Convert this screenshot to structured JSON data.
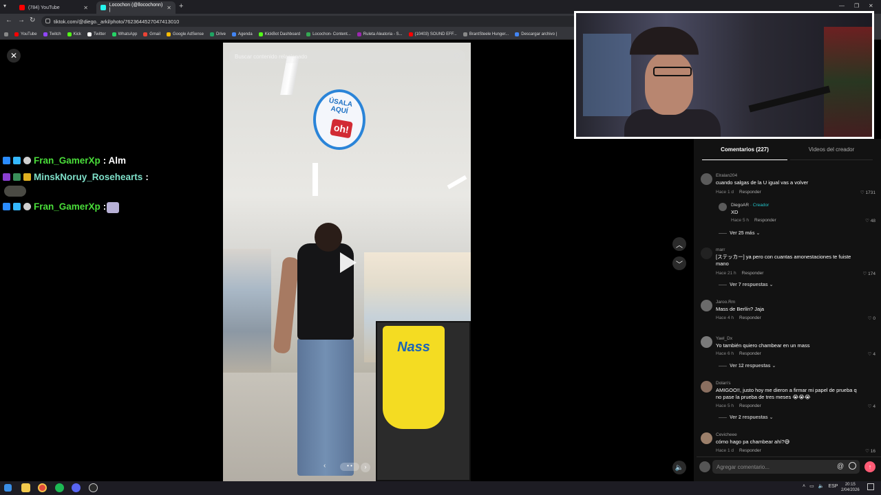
{
  "browser": {
    "tabs": [
      {
        "title": "(784) YouTube",
        "color": "#ff0000"
      },
      {
        "title": "Locochon (@llocochonn) |",
        "color": "#25f4ee"
      }
    ],
    "url": "tiktok.com/@diego._arkl/photo/7623644527047413010",
    "bookmarks": [
      {
        "label": "YouTube",
        "color": "#ff0000"
      },
      {
        "label": "Twitch",
        "color": "#9146ff"
      },
      {
        "label": "Kick",
        "color": "#53fc18"
      },
      {
        "label": "Twitter",
        "color": "#ffffff"
      },
      {
        "label": "WhatsApp",
        "color": "#25d366"
      },
      {
        "label": "Gmail",
        "color": "#ea4335"
      },
      {
        "label": "Google AdSense",
        "color": "#fbbc04"
      },
      {
        "label": "Drive",
        "color": "#1fa463"
      },
      {
        "label": "Agenda",
        "color": "#4285f4"
      },
      {
        "label": "KickBot Dashboard",
        "color": "#53fc18"
      },
      {
        "label": "Locochon- Content...",
        "color": "#34a853"
      },
      {
        "label": "Ruleta Aleatoria - S...",
        "color": "#9c27b0"
      },
      {
        "label": "(10403) SOUND EFF...",
        "color": "#ff0000"
      },
      {
        "label": "BrantSteele Hunger...",
        "color": "#888888"
      },
      {
        "label": "Descargar archivo |",
        "color": "#4285f4"
      }
    ]
  },
  "video": {
    "search_placeholder": "Buscar contenido relacionado",
    "sign_text": "ÚSALA AQUÍ",
    "sign_brand": "oh!",
    "apron_text": "Nass"
  },
  "chat": [
    {
      "user": "Fran_GamerXp",
      "message": ": Alm"
    },
    {
      "user": "MinskNoruy_Rosehearts",
      "message": ":"
    },
    {
      "user": "Fran_GamerXp",
      "message": ":"
    }
  ],
  "panel": {
    "tab_comments": "Comentarios (227)",
    "tab_creator": "Videos del creador",
    "reply_label": "Responder",
    "comments": [
      {
        "user": "Elralan204",
        "text": "cuando salgas de la U igual vas a volver",
        "time": "Hace 1 d",
        "likes": "1731"
      },
      {
        "user": "DiegoAR",
        "creator": "· Creador",
        "text": "XD",
        "time": "Hace 5 h",
        "likes": "48"
      },
      {
        "user": "marr",
        "text": "[ステッカー] ya pero con cuantas amonestaciones te fuiste mano",
        "time": "Hace 21 h",
        "likes": "174"
      },
      {
        "user": "Jaroo.Rm",
        "text": "Mass de Berlín? Jaja",
        "time": "Hace 4 h",
        "likes": "0"
      },
      {
        "user": "Yael_Dx",
        "text": "Yo también quiero chambear en un mass",
        "time": "Hace 6 h",
        "likes": "4"
      },
      {
        "user": "Dolan's",
        "text": "AMIGOO!!, justo hoy me dieron a firmar mi papel de prueba q no pase la prueba de tres meses 😭😭😭",
        "time": "Hace 5 h",
        "likes": "4"
      },
      {
        "user": "Cevicheee",
        "text": "cómo hago pa chambear ahí?😅",
        "time": "Hace 1 d",
        "likes": "16"
      }
    ],
    "replies": [
      "Ver 25 más",
      "Ver 7 respuestas",
      "Ver 12 respuestas",
      "Ver 2 respuestas"
    ],
    "comment_placeholder": "Agregar comentario..."
  },
  "taskbar": {
    "lang": "ESP",
    "time": "20:15",
    "date": "2/04/2026"
  }
}
